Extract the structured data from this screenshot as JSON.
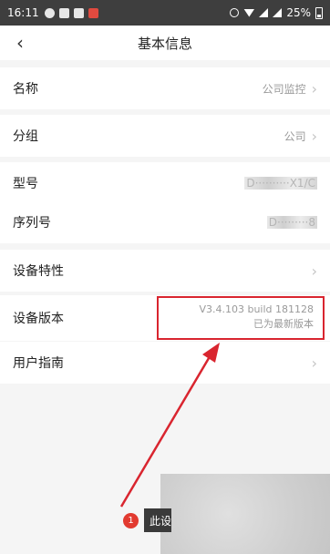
{
  "status_bar": {
    "time": "16:11",
    "battery": "25%"
  },
  "header": {
    "title": "基本信息"
  },
  "rows": {
    "name": {
      "label": "名称",
      "value": "公司监控"
    },
    "group": {
      "label": "分组",
      "value": "公司"
    },
    "model": {
      "label": "型号",
      "value": "D··········X1/C"
    },
    "serial": {
      "label": "序列号",
      "value": "D·········8"
    },
    "features": {
      "label": "设备特性"
    },
    "version": {
      "label": "设备版本",
      "value": "V3.4.103 build 181128",
      "status": "已为最新版本"
    },
    "guide": {
      "label": "用户指南"
    }
  },
  "annotation": {
    "badge": "1",
    "tooltip": "此设"
  },
  "colors": {
    "highlight": "#d9252f",
    "statusbar": "#3e3e3e"
  }
}
